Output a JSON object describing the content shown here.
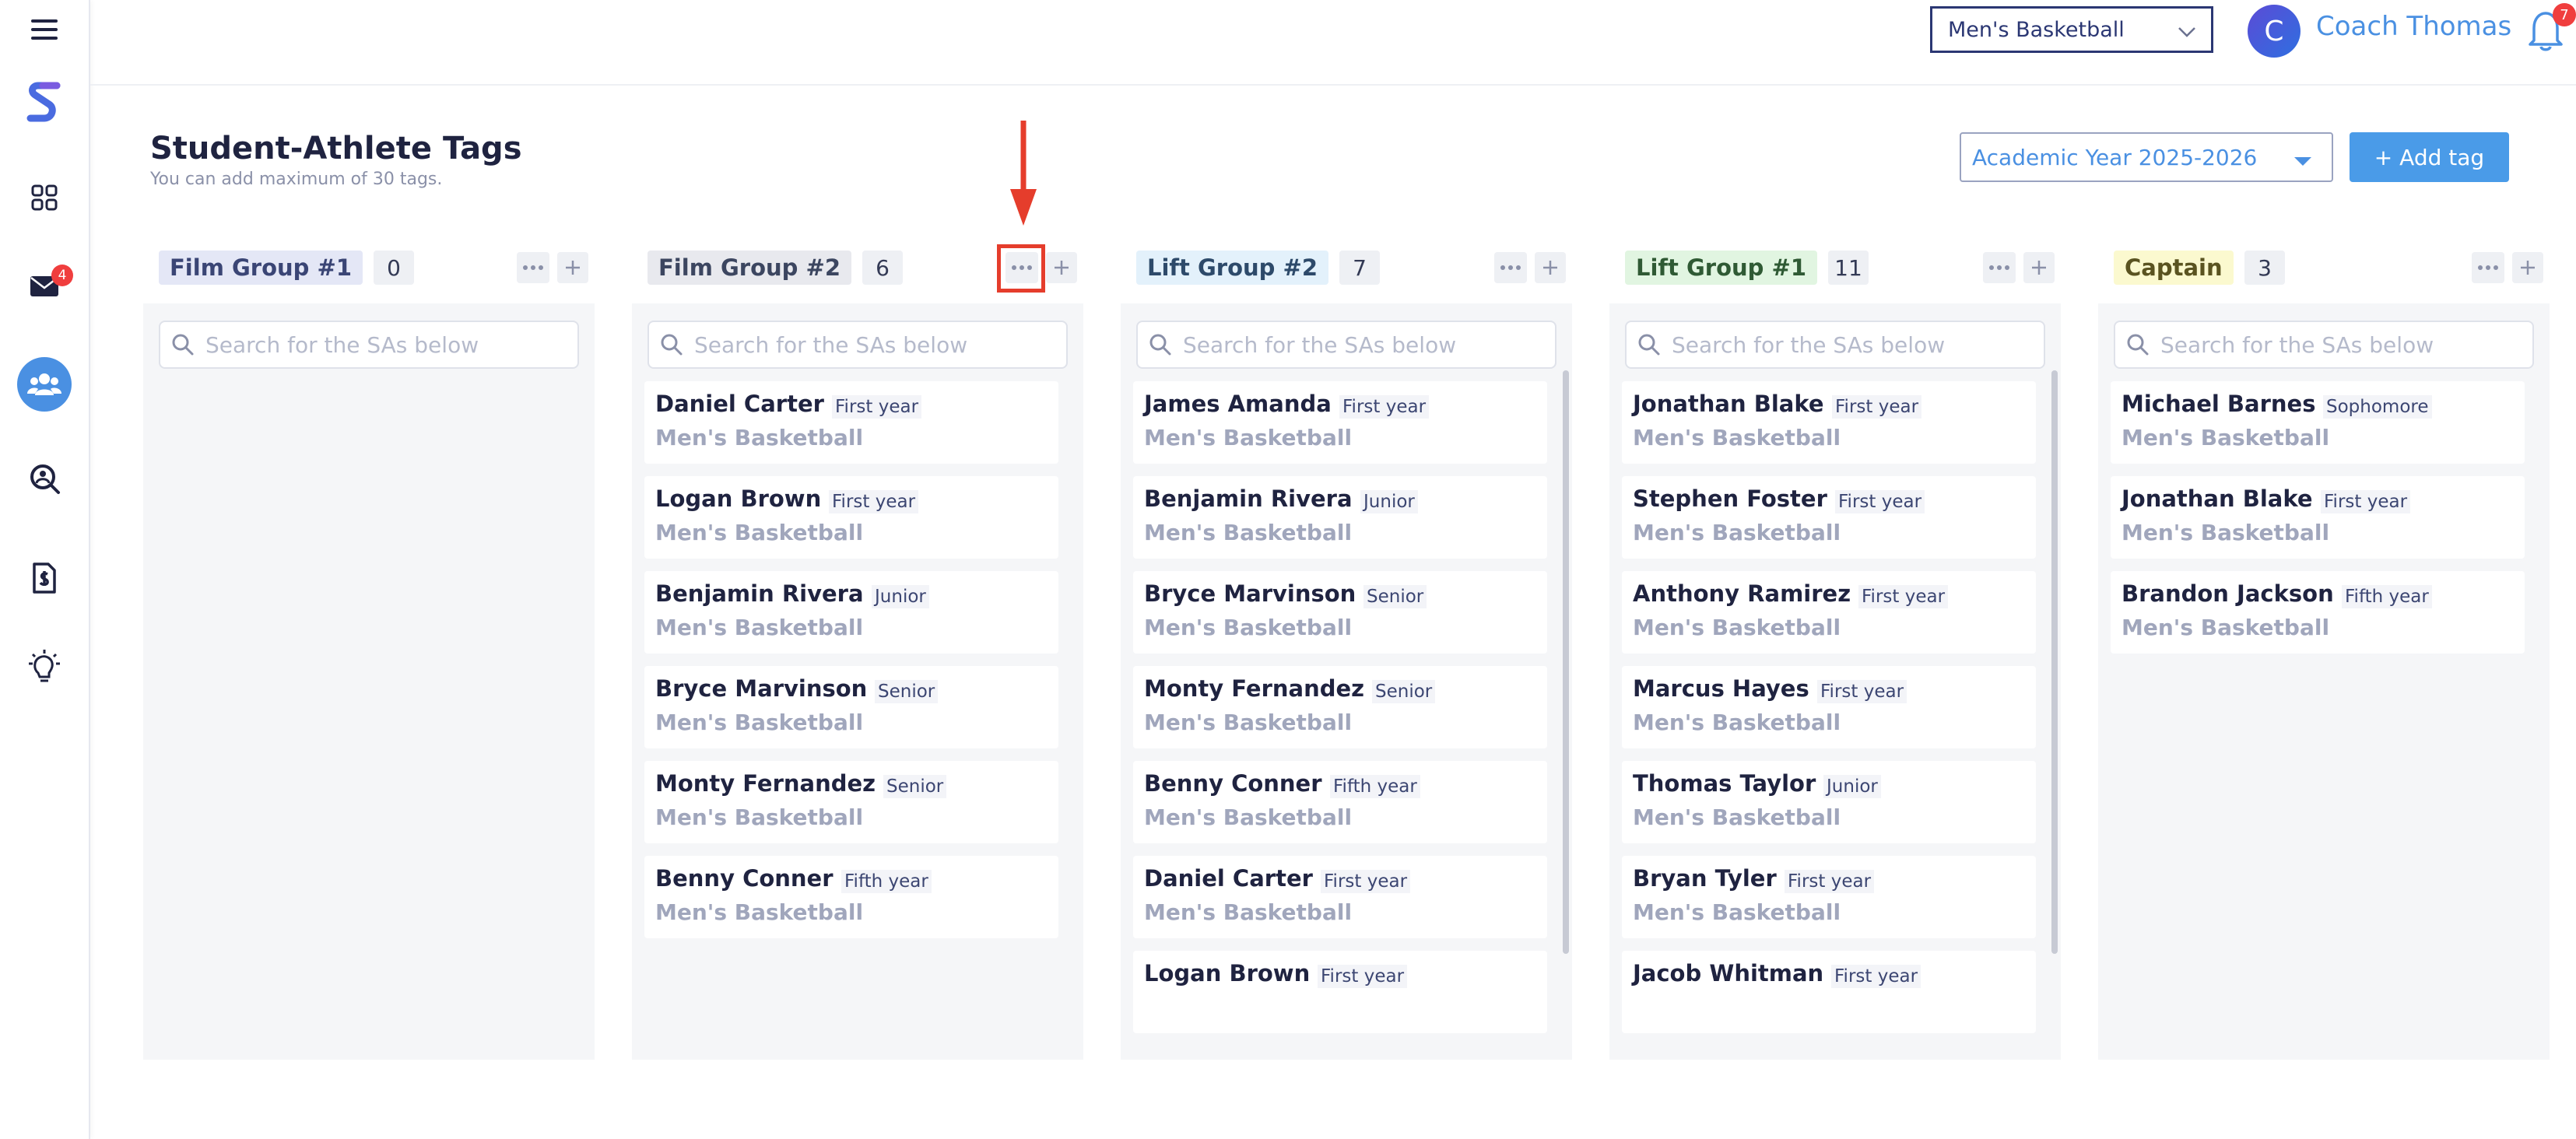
{
  "sidebar": {
    "items": [
      {
        "name": "menu-icon"
      },
      {
        "name": "app-logo"
      },
      {
        "name": "dashboard-icon"
      },
      {
        "name": "mail-icon",
        "badge": "4"
      },
      {
        "name": "team-icon",
        "active": true
      },
      {
        "name": "search-person-icon"
      },
      {
        "name": "document-icon"
      },
      {
        "name": "lightbulb-icon"
      }
    ]
  },
  "header": {
    "sport": "Men's Basketball",
    "avatar_letter": "C",
    "user_name": "Coach Thomas",
    "notification_count": "7"
  },
  "page": {
    "title": "Student-Athlete Tags",
    "subtitle": "You can add maximum of 30 tags.",
    "year_select": "Academic Year 2025-2026",
    "add_tag_label": "+ Add tag"
  },
  "search_placeholder": "Search for the SAs below",
  "colors": {
    "accent": "#4a90e2",
    "annotation": "#e53d2c"
  },
  "columns": [
    {
      "tag": "Film Group #1",
      "count": "0",
      "chip_bg": "#e4e7f6",
      "chip_color": "#3a4575",
      "athletes": []
    },
    {
      "tag": "Film Group #2",
      "count": "6",
      "chip_bg": "#e8e9ee",
      "chip_color": "#3c4660",
      "athletes": [
        {
          "name": "Daniel Carter",
          "year": "First year",
          "team": "Men's Basketball"
        },
        {
          "name": "Logan Brown",
          "year": "First year",
          "team": "Men's Basketball"
        },
        {
          "name": "Benjamin Rivera",
          "year": "Junior",
          "team": "Men's Basketball"
        },
        {
          "name": "Bryce Marvinson",
          "year": "Senior",
          "team": "Men's Basketball"
        },
        {
          "name": "Monty Fernandez",
          "year": "Senior",
          "team": "Men's Basketball"
        },
        {
          "name": "Benny Conner",
          "year": "Fifth year",
          "team": "Men's Basketball"
        }
      ]
    },
    {
      "tag": "Lift Group #2",
      "count": "7",
      "chip_bg": "#e3f1fb",
      "chip_color": "#2d4a6a",
      "athletes": [
        {
          "name": "James Amanda",
          "year": "First year",
          "team": "Men's Basketball"
        },
        {
          "name": "Benjamin Rivera",
          "year": "Junior",
          "team": "Men's Basketball"
        },
        {
          "name": "Bryce Marvinson",
          "year": "Senior",
          "team": "Men's Basketball"
        },
        {
          "name": "Monty Fernandez",
          "year": "Senior",
          "team": "Men's Basketball"
        },
        {
          "name": "Benny Conner",
          "year": "Fifth year",
          "team": "Men's Basketball"
        },
        {
          "name": "Daniel Carter",
          "year": "First year",
          "team": "Men's Basketball"
        },
        {
          "name": "Logan Brown",
          "year": "First year",
          "team": ""
        }
      ]
    },
    {
      "tag": "Lift Group #1",
      "count": "11",
      "chip_bg": "#e1f5e1",
      "chip_color": "#2f5a34",
      "athletes": [
        {
          "name": "Jonathan Blake",
          "year": "First year",
          "team": "Men's Basketball"
        },
        {
          "name": "Stephen Foster",
          "year": "First year",
          "team": "Men's Basketball"
        },
        {
          "name": "Anthony Ramirez",
          "year": "First year",
          "team": "Men's Basketball"
        },
        {
          "name": "Marcus Hayes",
          "year": "First year",
          "team": "Men's Basketball"
        },
        {
          "name": "Thomas Taylor",
          "year": "Junior",
          "team": "Men's Basketball"
        },
        {
          "name": "Bryan Tyler",
          "year": "First year",
          "team": "Men's Basketball"
        },
        {
          "name": "Jacob Whitman",
          "year": "First year",
          "team": ""
        }
      ]
    },
    {
      "tag": "Captain",
      "count": "3",
      "chip_bg": "#fbf9cf",
      "chip_color": "#5a5320",
      "athletes": [
        {
          "name": "Michael Barnes",
          "year": "Sophomore",
          "team": "Men's Basketball"
        },
        {
          "name": "Jonathan Blake",
          "year": "First year",
          "team": "Men's Basketball"
        },
        {
          "name": "Brandon Jackson",
          "year": "Fifth year",
          "team": "Men's Basketball"
        }
      ]
    }
  ]
}
